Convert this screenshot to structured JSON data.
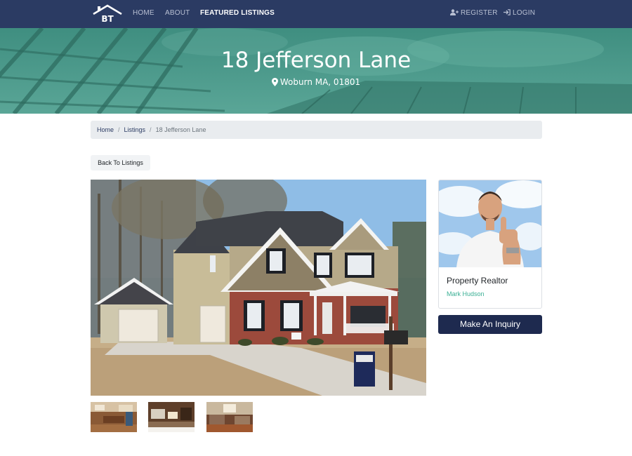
{
  "nav": {
    "logo_text": "BT",
    "links": [
      {
        "label": "HOME"
      },
      {
        "label": "ABOUT"
      },
      {
        "label": "FEATURED LISTINGS"
      }
    ],
    "register_label": "REGISTER",
    "login_label": "LOGIN",
    "icons": {
      "register": "user-plus-icon",
      "login": "sign-in-icon"
    }
  },
  "hero": {
    "title": "18 Jefferson Lane",
    "location": "Woburn MA, 01801",
    "location_icon": "map-pin-icon"
  },
  "breadcrumb": {
    "items": [
      {
        "label": "Home"
      },
      {
        "label": "Listings"
      },
      {
        "label": "18 Jefferson Lane"
      }
    ]
  },
  "back_button": {
    "label": "Back To Listings"
  },
  "realtor": {
    "title": "Property Realtor",
    "name": "Mark Hudson"
  },
  "inquiry_button": {
    "label": "Make An Inquiry"
  },
  "colors": {
    "navbar": "#2b3b63",
    "hero": "#4c9a8a",
    "accent_green": "#3aaf94",
    "button_dark": "#1e2a4f"
  }
}
